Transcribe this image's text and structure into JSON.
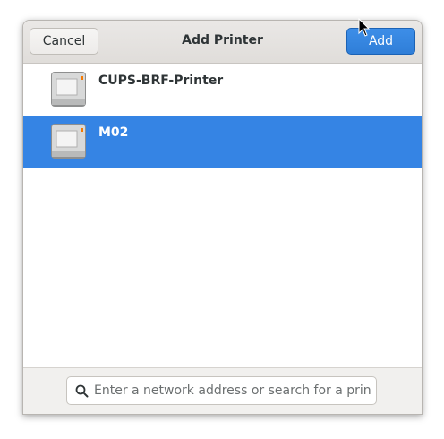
{
  "dialog": {
    "title": "Add Printer",
    "cancel_label": "Cancel",
    "add_label": "Add"
  },
  "printers": [
    {
      "name": "CUPS-BRF-Printer",
      "icon": "printer-icon",
      "selected": false
    },
    {
      "name": "M02",
      "icon": "printer-icon",
      "selected": true
    }
  ],
  "search": {
    "placeholder": "Enter a network address or search for a printer",
    "value": ""
  },
  "colors": {
    "accent": "#3584e4",
    "header_bg": "#e6e4e1",
    "footer_bg": "#f1f0ee"
  }
}
